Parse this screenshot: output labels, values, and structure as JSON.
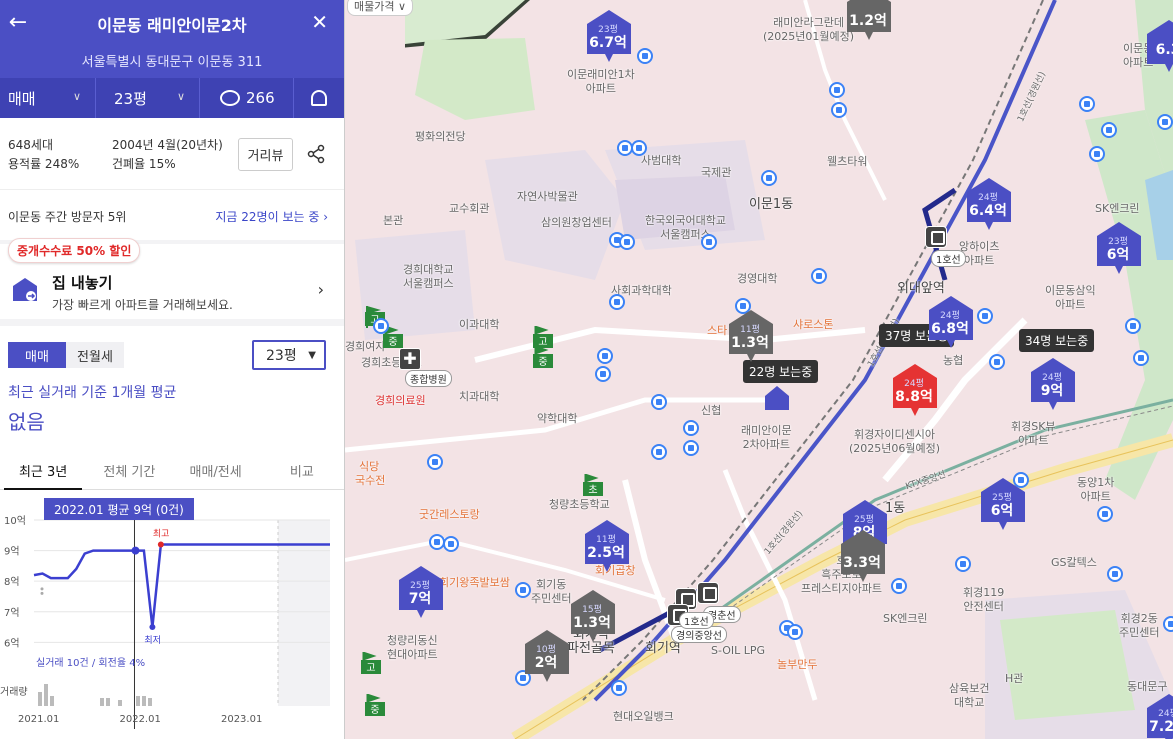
{
  "header": {
    "back": "←",
    "title": "이문동 래미안이문2차",
    "close": "✕",
    "address": "서울특별시 동대문구 이문동 311"
  },
  "tabsbar": {
    "trade_type": "매매",
    "size": "23평",
    "comments": "266"
  },
  "info": {
    "households": "648세대",
    "far": "용적률 248%",
    "built": "2004년 4월(20년차)",
    "bcr": "건폐율 15%",
    "street_view": "거리뷰"
  },
  "visitor": {
    "rank": "이문동 주간 방문자 5위",
    "now": "지금 22명이 보는 중 ›"
  },
  "promo": {
    "badge": "중개수수료 50% 할인",
    "title": "집 내놓기",
    "desc": "가장 빠르게 아파트를 거래해보세요."
  },
  "trade": {
    "seg_on": "매매",
    "seg_off": "전월세",
    "size_select": "23평",
    "basis": "최근 실거래 기준 1개월 평균",
    "value": "없음"
  },
  "period_tabs": [
    "최근 3년",
    "전체 기간",
    "매매/전세",
    "비교"
  ],
  "chart_data": {
    "type": "line",
    "tooltip": "2022.01 평균 9억 (0건)",
    "yticks": [
      "10억",
      "9억",
      "8억",
      "7억",
      "6억"
    ],
    "ylim": [
      5.75,
      10
    ],
    "xticks": [
      "2021.01",
      "2022.01",
      "2023.01"
    ],
    "x": [
      "2021.01",
      "2021.02",
      "2021.03",
      "2021.04",
      "2021.05",
      "2021.06",
      "2021.07",
      "2021.08",
      "2021.09",
      "2021.10",
      "2021.11",
      "2021.12",
      "2022.01",
      "2022.02",
      "2022.03",
      "2022.04",
      "2022.05",
      "2022.06",
      "2022.07",
      "2022.08",
      "2022.09",
      "2022.10",
      "2022.11",
      "2022.12",
      "2023.01",
      "2023.02",
      "2023.03",
      "2023.04",
      "2023.05",
      "2023.06",
      "2023.07",
      "2023.08",
      "2023.09",
      "2023.10",
      "2023.11",
      "2023.12"
    ],
    "series": [
      {
        "values": [
          8.2,
          8.25,
          8.1,
          8.1,
          8.1,
          8.4,
          8.9,
          9.0,
          9.0,
          9.0,
          9.0,
          9.0,
          9.0,
          9.0,
          6.5,
          9.2,
          9.2,
          9.2,
          9.2,
          9.2,
          9.2,
          9.2,
          9.2,
          9.2,
          9.2,
          9.2,
          9.2,
          9.2,
          9.2,
          9.2,
          9.2,
          9.2,
          9.2,
          9.2,
          9.2,
          9.2
        ]
      }
    ],
    "labels": {
      "high": "최고",
      "low": "최저"
    },
    "footnote": "실거래 10건 / 회전율 4%",
    "volume_label": "거래량",
    "colors": {
      "line": "#3b3fd0",
      "high": "#e02929",
      "low": "#3b3fd0"
    }
  },
  "map": {
    "filter": "매물가격",
    "markers": [
      {
        "size": "23평",
        "price": "6.7억",
        "color": "#4b4fc4"
      },
      {
        "size": "24평",
        "price": "6.4억",
        "color": "#4b4fc4"
      },
      {
        "size": "23평",
        "price": "6억",
        "color": "#4b4fc4"
      },
      {
        "size": "24평",
        "price": "6.8억",
        "color": "#4b4fc4"
      },
      {
        "size": "24평",
        "price": "9억",
        "color": "#4b4fc4"
      },
      {
        "size": "24평",
        "price": "8.8억",
        "color": "#e53333"
      },
      {
        "size": "25평",
        "price": "6억",
        "color": "#4b4fc4"
      },
      {
        "size": "25평",
        "price": "8억",
        "color": "#4b4fc4"
      },
      {
        "size": "11평",
        "price": "2.5억",
        "color": "#4b4fc4"
      },
      {
        "size": "25평",
        "price": "7억",
        "color": "#4b4fc4"
      },
      {
        "size": "11평",
        "price": "1.3억",
        "color": "#666666"
      },
      {
        "size": "15평",
        "price": "1.3억",
        "color": "#666666"
      },
      {
        "size": "10평",
        "price": "2억",
        "color": "#666666"
      },
      {
        "size": "",
        "price": "3.3억",
        "color": "#666666"
      },
      {
        "size": "",
        "price": "1.2억",
        "color": "#666666"
      },
      {
        "size": "24평",
        "price": "7.2억",
        "color": "#4b4fc4"
      },
      {
        "size": "",
        "price": "6.3",
        "color": "#4b4fc4"
      }
    ],
    "tooltips": [
      "37명 보는중",
      "34명 보는중",
      "22명 보는중"
    ],
    "labels": {
      "l1": "이문래미안1차\n아파트",
      "l2": "래미안라그란데\n(2025년01월예정)",
      "l3": "평화의전당",
      "l4": "자연사박물관",
      "l5": "교수회관",
      "l6": "사범대학",
      "l7": "국제관",
      "l8": "웰츠타워",
      "l9": "삼의원창업센터",
      "l10": "한국외국어대학교\n서울캠퍼스",
      "l11": "이문1동",
      "l12": "경희대학교\n서울캠퍼스",
      "l13": "이과대학",
      "l14": "사회과학대학",
      "l15": "경영대학",
      "l16": "경희여자",
      "l17": "경희의료원",
      "l18": "치과대학",
      "l19": "약학대학",
      "l20": "신협",
      "l21": "래미안이문\n2차아파트",
      "l22": "휘경자이디센시아\n(2025년06월예정)",
      "l23": "휘경SK뷰\n아파트",
      "l24": "이문동삼익\n아파트",
      "l25": "SK엔크린",
      "l26": "외대앞역",
      "l27": "청량초등학교",
      "l28": "굿간레스토랑",
      "l29": "회기왕족발보쌈",
      "l30": "회기동\n주민센터",
      "l31": "회기역\n파전골목",
      "l32": "회기역",
      "l33": "S-OIL LPG",
      "l34": "놀부만두",
      "l35": "휘경119\n안전센터",
      "l36": "SK엔크린",
      "l37": "GS칼텍스",
      "l38": "휘경2동\n주민센터",
      "l39": "삼육보건\n대학교",
      "l40": "청량리동신\n현대아파트",
      "l41": "현대오일뱅크",
      "l42": "동양1차\n아파트",
      "l43": "동대문구",
      "l44": "호\n흑주포로\n프레스티지아파트",
      "l45": "스타",
      "l46": "샤로스톤",
      "l47": "농협",
      "l48": "이문동\n아파트",
      "l49": "앙하이츠\n아파트",
      "l50": "본관",
      "l51": "경희초등학교",
      "l52": "국수전",
      "l53": "1동",
      "l54": "H관",
      "l55": "휘경2동",
      "l56": "식당",
      "l57": "회기곱창"
    },
    "station_tags": [
      "1호선",
      "경춘선",
      "경의중앙선",
      "1호선"
    ],
    "hospital_tag": "종합병원",
    "school_badges": [
      "고",
      "중",
      "고",
      "중",
      "초",
      "고",
      "중",
      "고"
    ],
    "line_labels": [
      "1호선(경원선)",
      "1호선(경원선)",
      "KTX중앙선",
      "1호선(경원선)"
    ]
  }
}
